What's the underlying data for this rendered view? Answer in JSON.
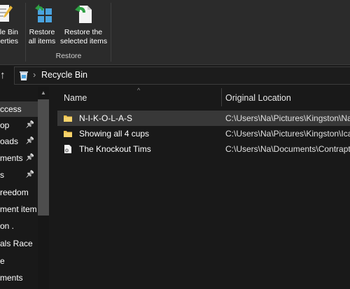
{
  "ribbon": {
    "properties_label": "cle Bin\nerties",
    "restore_all_label": "Restore\nall items",
    "restore_selected_label": "Restore the\nselected items",
    "group_label": "Restore"
  },
  "address": {
    "location": "Recycle Bin"
  },
  "nav": {
    "items": [
      {
        "label": "ccess",
        "pinned": false,
        "selected": true
      },
      {
        "label": "op",
        "pinned": true,
        "selected": false
      },
      {
        "label": "oads",
        "pinned": true,
        "selected": false
      },
      {
        "label": "ments",
        "pinned": true,
        "selected": false
      },
      {
        "label": "s",
        "pinned": true,
        "selected": false
      },
      {
        "label": "reedom",
        "pinned": false,
        "selected": false
      },
      {
        "label": "ment item",
        "pinned": false,
        "selected": false
      },
      {
        "label": "on  .",
        "pinned": false,
        "selected": false
      },
      {
        "label": "als Race",
        "pinned": false,
        "selected": false
      },
      {
        "label": "e",
        "pinned": false,
        "selected": false
      },
      {
        "label": "ments",
        "pinned": false,
        "selected": false
      }
    ]
  },
  "list": {
    "columns": {
      "name": "Name",
      "location": "Original Location"
    },
    "rows": [
      {
        "name": "N-I-K-O-L-A-S",
        "location": "C:\\Users\\Na\\Pictures\\Kingston\\Na",
        "icon": "folder-icon",
        "selected": true
      },
      {
        "name": "Showing all 4 cups",
        "location": "C:\\Users\\Na\\Pictures\\Kingston\\Ica",
        "icon": "folder-icon",
        "selected": false
      },
      {
        "name": "The Knockout Tims",
        "location": "C:\\Users\\Na\\Documents\\Contrapt",
        "icon": "gear-file-icon",
        "selected": false
      }
    ]
  },
  "colors": {
    "background": "#191919",
    "ribbon": "#2b2b2b",
    "selection": "#383838",
    "folder": "#f0c14b",
    "restore_arrow": "#2ea043",
    "tile_blue": "#4aa3df"
  }
}
